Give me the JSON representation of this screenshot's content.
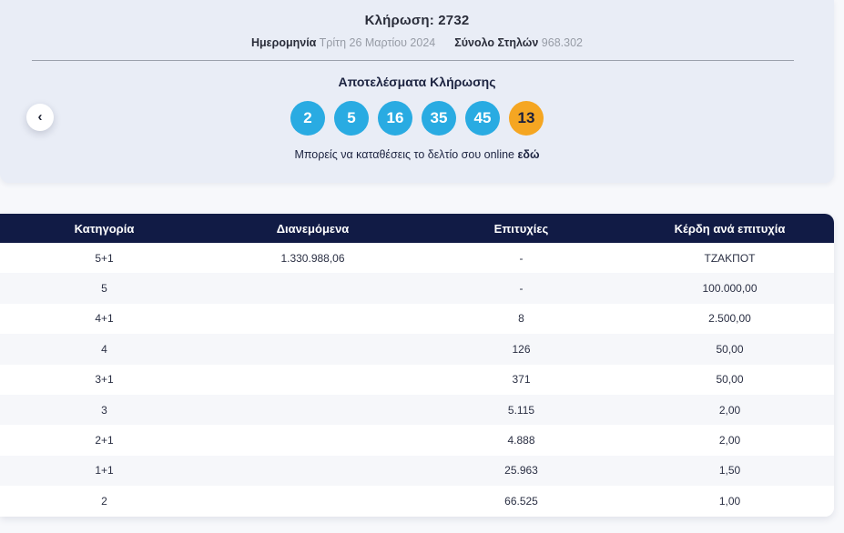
{
  "draw": {
    "title": "Κλήρωση: 2732",
    "date_label": "Ημερομηνία",
    "date_value": "Τρίτη 26 Μαρτίου 2024",
    "columns_label": "Σύνολο Στηλών",
    "columns_value": "968.302"
  },
  "results": {
    "title": "Αποτελέσματα Κλήρωσης",
    "numbers": [
      "2",
      "5",
      "16",
      "35",
      "45"
    ],
    "bonus": "13",
    "cta_text": "Μπορείς να καταθέσεις το δελτίο σου online ",
    "cta_link_label": "εδώ"
  },
  "nav": {
    "prev_label": "‹"
  },
  "table": {
    "headers": [
      "Κατηγορία",
      "Διανεμόμενα",
      "Επιτυχίες",
      "Κέρδη ανά επιτυχία"
    ],
    "rows": [
      {
        "category": "5+1",
        "distributed": "1.330.988,06",
        "winners": "-",
        "prize": "ΤΖΑΚΠΟΤ"
      },
      {
        "category": "5",
        "distributed": "",
        "winners": "-",
        "prize": "100.000,00"
      },
      {
        "category": "4+1",
        "distributed": "",
        "winners": "8",
        "prize": "2.500,00"
      },
      {
        "category": "4",
        "distributed": "",
        "winners": "126",
        "prize": "50,00"
      },
      {
        "category": "3+1",
        "distributed": "",
        "winners": "371",
        "prize": "50,00"
      },
      {
        "category": "3",
        "distributed": "",
        "winners": "5.115",
        "prize": "2,00"
      },
      {
        "category": "2+1",
        "distributed": "",
        "winners": "4.888",
        "prize": "2,00"
      },
      {
        "category": "1+1",
        "distributed": "",
        "winners": "25.963",
        "prize": "1,50"
      },
      {
        "category": "2",
        "distributed": "",
        "winners": "66.525",
        "prize": "1,00"
      }
    ]
  },
  "colors": {
    "number_ball": "#29abe2",
    "bonus_ball": "#f5a622",
    "table_header": "#111b45",
    "panel_background": "#e9edf6"
  }
}
